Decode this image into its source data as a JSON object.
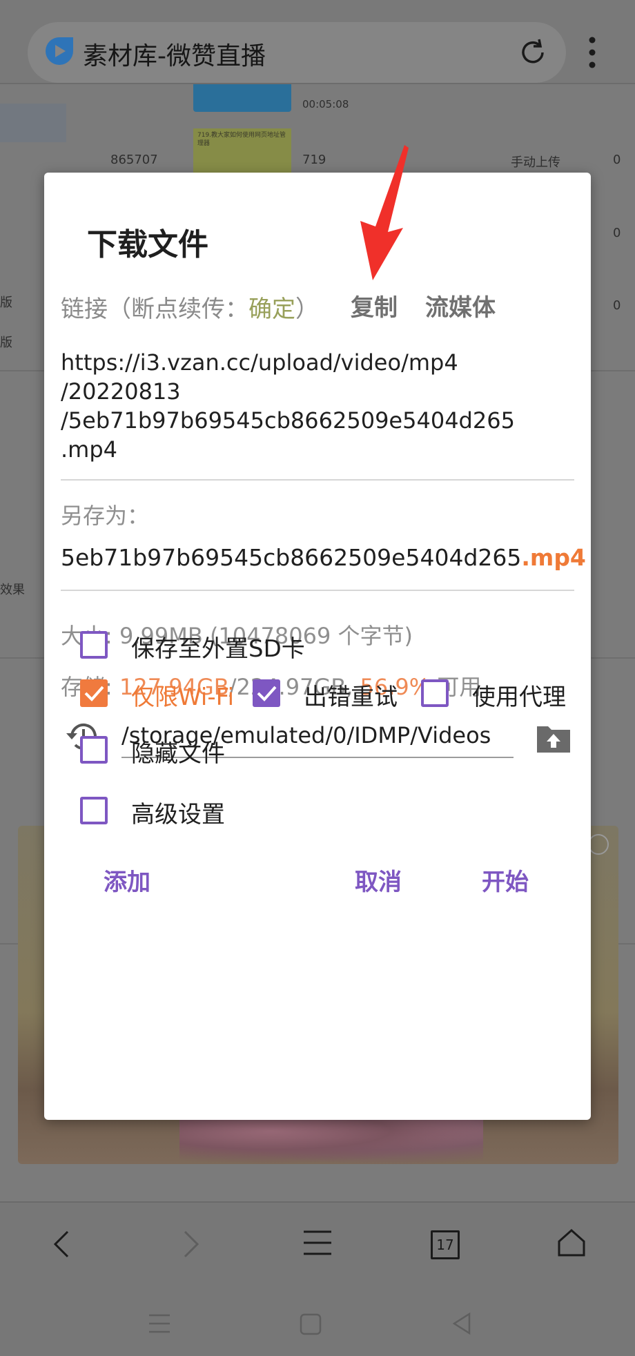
{
  "browser": {
    "title": "素材库-微赞直播",
    "icons": [
      "app-logo-icon",
      "reload-icon",
      "more-vert-icon"
    ]
  },
  "background_page": {
    "cells": [
      "00:05:08",
      "865707",
      "719",
      "手动上传",
      "0",
      "0",
      "0",
      "版",
      "版",
      "效果"
    ],
    "thumbnail_text": "719.教大家如何使用网页地址管理器"
  },
  "dialog": {
    "title": "下载文件",
    "link_label_prefix": "链接（断点续传：",
    "link_label_ok": "确定",
    "link_label_suffix": "）",
    "copy_label": "复制",
    "stream_label": "流媒体",
    "url": "https://i3.vzan.cc/upload/video/mp4\n/20220813\n/5eb71b97b69545cb8662509e5404d265\n.mp4",
    "saveas_label": "另存为：",
    "filename_base": "5eb71b97b69545cb8662509e5404d265",
    "filename_ext": ".mp4",
    "size_text": "大小: 9.99MB (10478069 个字节)",
    "storage_label": "存储: ",
    "storage_free": "127.94GB",
    "storage_total": "/224.97GB, ",
    "storage_percent": "56.9%",
    "storage_suffix": " 可用",
    "path": "/storage/emulated/0/IDMP/Videos",
    "options": {
      "sd_card": {
        "label": "保存至外置SD卡",
        "checked": false
      },
      "wifi_only": {
        "label": "仅限Wi-Fi",
        "checked": true
      },
      "retry": {
        "label": "出错重试",
        "checked": true
      },
      "proxy": {
        "label": "使用代理",
        "checked": false
      },
      "hidden": {
        "label": "隐藏文件",
        "checked": false
      },
      "advanced": {
        "label": "高级设置",
        "checked": false
      }
    },
    "actions": {
      "add": "添加",
      "cancel": "取消",
      "start": "开始"
    }
  },
  "bottom_nav": {
    "tab_count": "17",
    "icons": [
      "back-icon",
      "forward-icon",
      "menu-icon",
      "tabs-icon",
      "home-icon"
    ]
  },
  "system_nav": {
    "icons": [
      "recent-apps-icon",
      "home-square-icon",
      "system-back-icon"
    ]
  },
  "colors": {
    "accent_purple": "#7e57c2",
    "accent_orange": "#ef7a37",
    "annotation_red": "#f0302a"
  }
}
